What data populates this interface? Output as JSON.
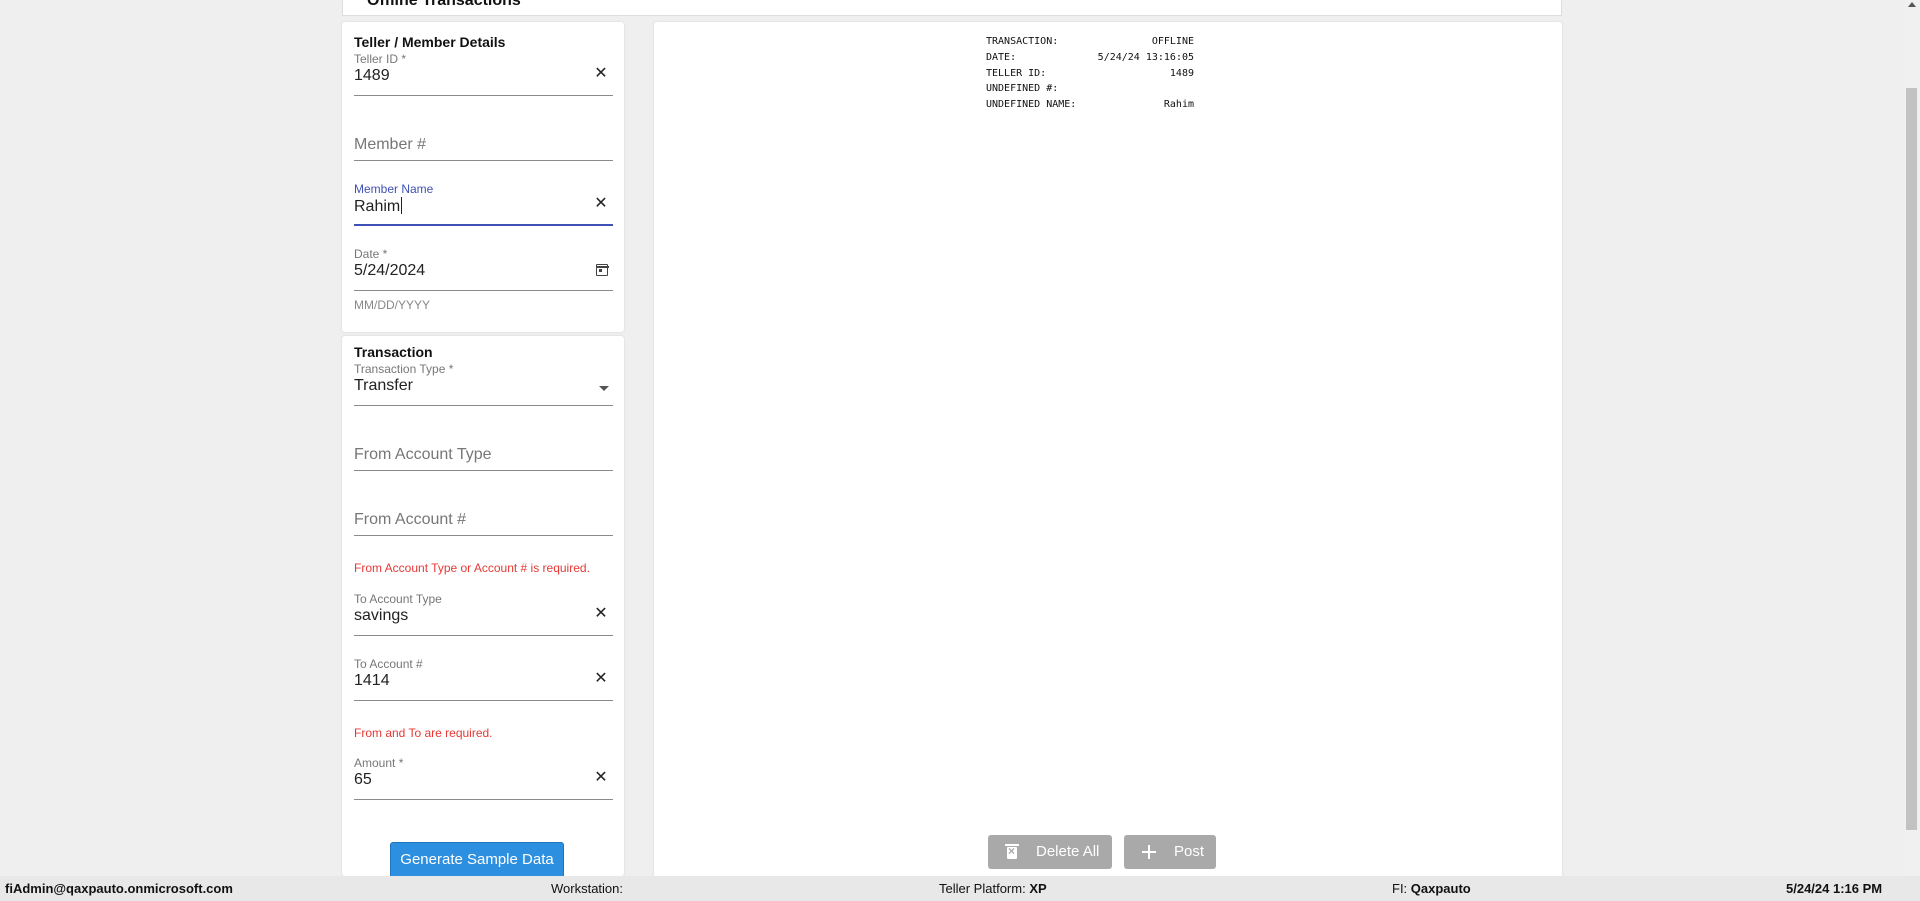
{
  "page": {
    "title": "Offline Transactions"
  },
  "teller_details": {
    "section_title": "Teller / Member Details",
    "teller_id": {
      "label": "Teller ID *",
      "value": "1489"
    },
    "member_number": {
      "placeholder": "Member #"
    },
    "member_name": {
      "label": "Member Name",
      "value": "Rahim"
    },
    "date": {
      "label": "Date *",
      "value": "5/24/2024",
      "helper": "MM/DD/YYYY"
    }
  },
  "transaction": {
    "section_title": "Transaction",
    "type": {
      "label": "Transaction Type *",
      "value": "Transfer"
    },
    "from_account_type": {
      "placeholder": "From Account Type"
    },
    "from_account_number": {
      "placeholder": "From Account #"
    },
    "from_error": "From Account Type or Account # is required.",
    "to_account_type": {
      "label": "To Account Type",
      "value": "savings"
    },
    "to_account_number": {
      "label": "To Account #",
      "value": "1414"
    },
    "to_error": "From and To are required.",
    "amount": {
      "label": "Amount *",
      "value": "65"
    },
    "generate_button": "Generate Sample Data"
  },
  "receipt": {
    "rows": [
      {
        "key": "TRANSACTION:",
        "value": "OFFLINE"
      },
      {
        "key": "DATE:",
        "value": "5/24/24 13:16:05"
      },
      {
        "key": "TELLER ID:",
        "value": "1489"
      },
      {
        "key": "UNDEFINED #:",
        "value": ""
      },
      {
        "key": "UNDEFINED NAME:",
        "value": "Rahim"
      }
    ]
  },
  "actions": {
    "delete_all": "Delete All",
    "post": "Post"
  },
  "status_bar": {
    "user": "fiAdmin@qaxpauto.onmicrosoft.com",
    "workstation_label": "Workstation:",
    "workstation_value": "",
    "platform_label": "Teller Platform:",
    "platform_value": "XP",
    "fi_label": "FI:",
    "fi_value": "Qaxpauto",
    "datetime": "5/24/24 1:16 PM"
  },
  "icons": {
    "clear": "close-icon",
    "calendar": "calendar-icon",
    "dropdown": "chevron-down-icon",
    "delete": "trash-icon",
    "post": "plus-icon"
  },
  "colors": {
    "accent": "#3f51b5",
    "error": "#e53935",
    "primary_button": "#2d8fe0",
    "disabled_button": "#a9a9a9"
  }
}
